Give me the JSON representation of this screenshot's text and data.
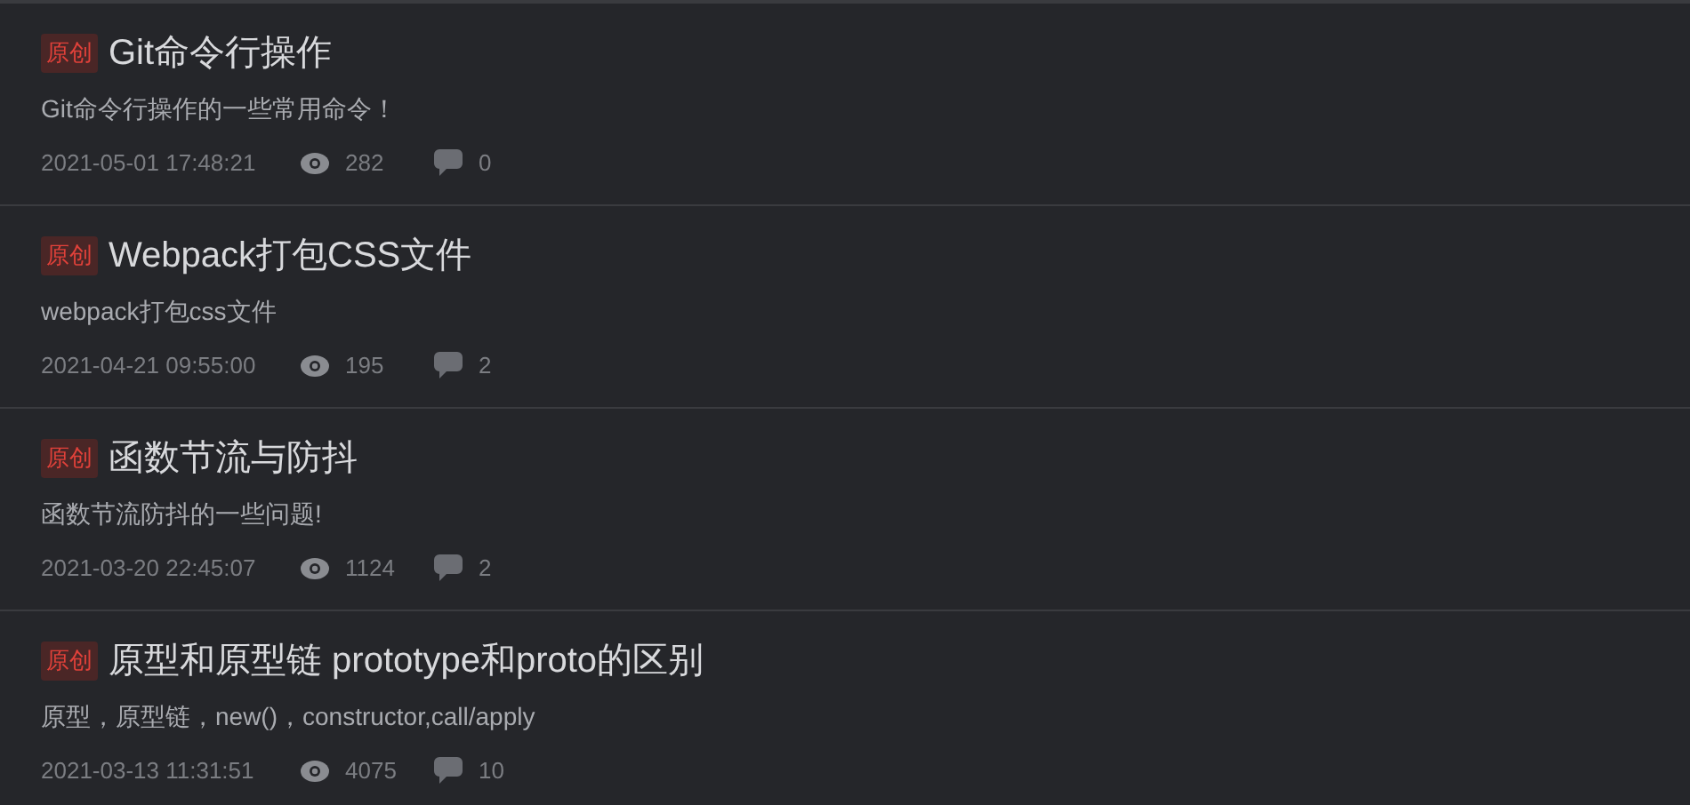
{
  "articles": [
    {
      "badge": "原创",
      "title": "Git命令行操作",
      "summary": "Git命令行操作的一些常用命令！",
      "date": "2021-05-01 17:48:21",
      "views": "282",
      "comments": "0"
    },
    {
      "badge": "原创",
      "title": "Webpack打包CSS文件",
      "summary": "webpack打包css文件",
      "date": "2021-04-21 09:55:00",
      "views": "195",
      "comments": "2"
    },
    {
      "badge": "原创",
      "title": "函数节流与防抖",
      "summary": "函数节流防抖的一些问题!",
      "date": "2021-03-20 22:45:07",
      "views": "1124",
      "comments": "2"
    },
    {
      "badge": "原创",
      "title": "原型和原型链 prototype和proto的区别",
      "summary": "原型，原型链，new()，constructor,call/apply",
      "date": "2021-03-13 11:31:51",
      "views": "4075",
      "comments": "10"
    }
  ]
}
